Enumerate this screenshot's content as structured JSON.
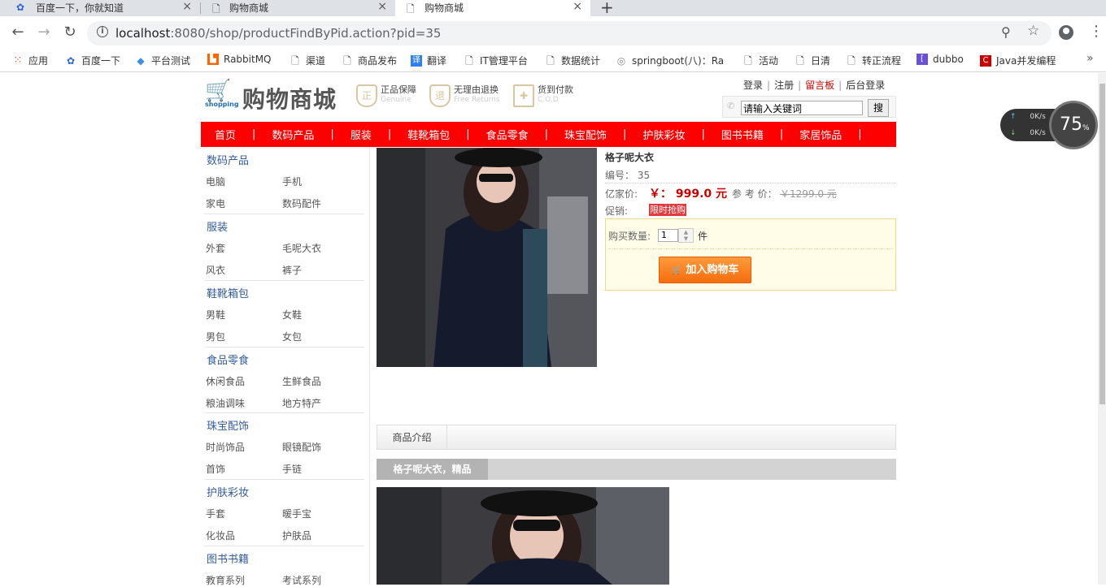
{
  "browser": {
    "tabs": [
      {
        "title": "百度一下，你就知道",
        "icon": "paw-icon",
        "active": false
      },
      {
        "title": "购物商城",
        "icon": "page-icon",
        "active": false
      },
      {
        "title": "购物商城",
        "icon": "page-icon",
        "active": true
      }
    ],
    "url_host": "localhost",
    "url_rest": ":8080/shop/productFindByPid.action?pid=35",
    "bookmarks": [
      {
        "label": "应用",
        "icon": "apps-grid-icon"
      },
      {
        "label": "百度一下",
        "icon": "paw-icon"
      },
      {
        "label": "平台测试",
        "icon": "diamond-icon"
      },
      {
        "label": "RabbitMQ",
        "icon": "rabbitmq-icon"
      },
      {
        "label": "渠道",
        "icon": "page-icon"
      },
      {
        "label": "商品发布",
        "icon": "page-icon"
      },
      {
        "label": "翻译",
        "icon": "translate-icon"
      },
      {
        "label": "IT管理平台",
        "icon": "page-icon"
      },
      {
        "label": "数据统计",
        "icon": "page-icon"
      },
      {
        "label": "springboot(八)：Ra",
        "icon": "globe-icon"
      },
      {
        "label": "活动",
        "icon": "page-icon"
      },
      {
        "label": "日清",
        "icon": "page-icon"
      },
      {
        "label": "转正流程",
        "icon": "page-icon"
      },
      {
        "label": "dubbo",
        "icon": "dubbo-icon"
      },
      {
        "label": "Java并发编程",
        "icon": "csdn-icon"
      }
    ],
    "bookmarks_more": "»"
  },
  "header": {
    "logo_word": "shopping",
    "site_title": "购物商城",
    "badges": [
      {
        "main": "正品保障",
        "sub": "Genuine"
      },
      {
        "main": "无理由退换",
        "sub": "Free Returns"
      },
      {
        "main": "货到付款",
        "sub": "C.O.D"
      }
    ],
    "top_links": [
      "登录",
      "注册",
      "留言板",
      "后台登录"
    ],
    "search_placeholder": "请输入关键词",
    "search_button": "搜"
  },
  "main_nav": [
    "首页",
    "数码产品",
    "服装",
    "鞋靴箱包",
    "食品零食",
    "珠宝配饰",
    "护肤彩妆",
    "图书书籍",
    "家居饰品"
  ],
  "categories": [
    {
      "title": "数码产品",
      "items": [
        "电脑",
        "手机",
        "家电",
        "数码配件"
      ]
    },
    {
      "title": "服装",
      "items": [
        "外套",
        "毛呢大衣",
        "风衣",
        "裤子"
      ]
    },
    {
      "title": "鞋靴箱包",
      "items": [
        "男鞋",
        "女鞋",
        "男包",
        "女包"
      ]
    },
    {
      "title": "食品零食",
      "items": [
        "休闲食品",
        "生鲜食品",
        "粮油调味",
        "地方特产"
      ]
    },
    {
      "title": "珠宝配饰",
      "items": [
        "时尚饰品",
        "眼镜配饰",
        "首饰",
        "手链"
      ]
    },
    {
      "title": "护肤彩妆",
      "items": [
        "手套",
        "暖手宝",
        "化妆品",
        "护肤品"
      ]
    },
    {
      "title": "图书书籍",
      "items": [
        "教育系列",
        "考试系列"
      ]
    }
  ],
  "product": {
    "name": "格子呢大衣",
    "code_label": "编号：",
    "code": "35",
    "price_label": "亿家价:",
    "price": "￥： 999.0 元",
    "market_label": "参 考 价：",
    "market_price": "￥1299.0 元",
    "promo_label": "促销:",
    "promo": "限时抢购",
    "qty_label": "购买数量:",
    "qty": "1",
    "qty_unit": "件",
    "add_to_cart": "加入购物车",
    "tab_intro": "商品介绍",
    "desc_title": "格子呢大衣，精品"
  },
  "net_widget": {
    "up": "0K/s",
    "down": "0K/s",
    "percent": "75",
    "percent_unit": "%"
  },
  "colors": {
    "nav_red": "#ff0000",
    "price_red": "#cc0000",
    "category_blue": "#335c9a",
    "cart_orange": "#f56d0e"
  }
}
